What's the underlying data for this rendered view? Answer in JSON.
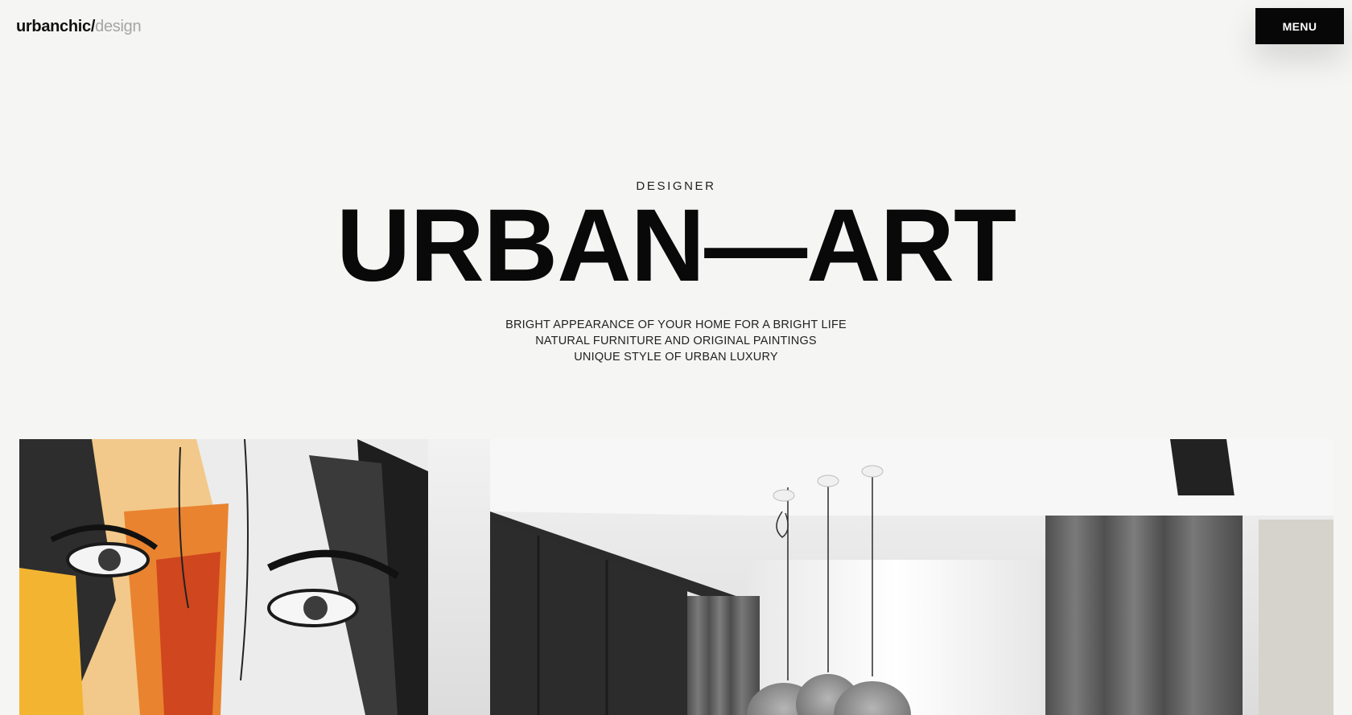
{
  "header": {
    "logo_main": "urbanchic/",
    "logo_sub": "design",
    "menu_label": "MENU"
  },
  "hero": {
    "eyebrow": "DESIGNER",
    "title": "URBAN—ART",
    "taglines": [
      "BRIGHT APPEARANCE OF YOUR HOME FOR A BRIGHT LIFE",
      "NATURAL FURNITURE AND ORIGINAL PAINTINGS",
      "UNIQUE STYLE OF URBAN LUXURY"
    ]
  },
  "colors": {
    "background": "#f5f5f4",
    "text": "#0b0b0b",
    "logo_muted": "#a5a5a5",
    "menu_bg": "#070707"
  },
  "icons": [
    "abstract-face-painting",
    "pendant-lamp"
  ]
}
